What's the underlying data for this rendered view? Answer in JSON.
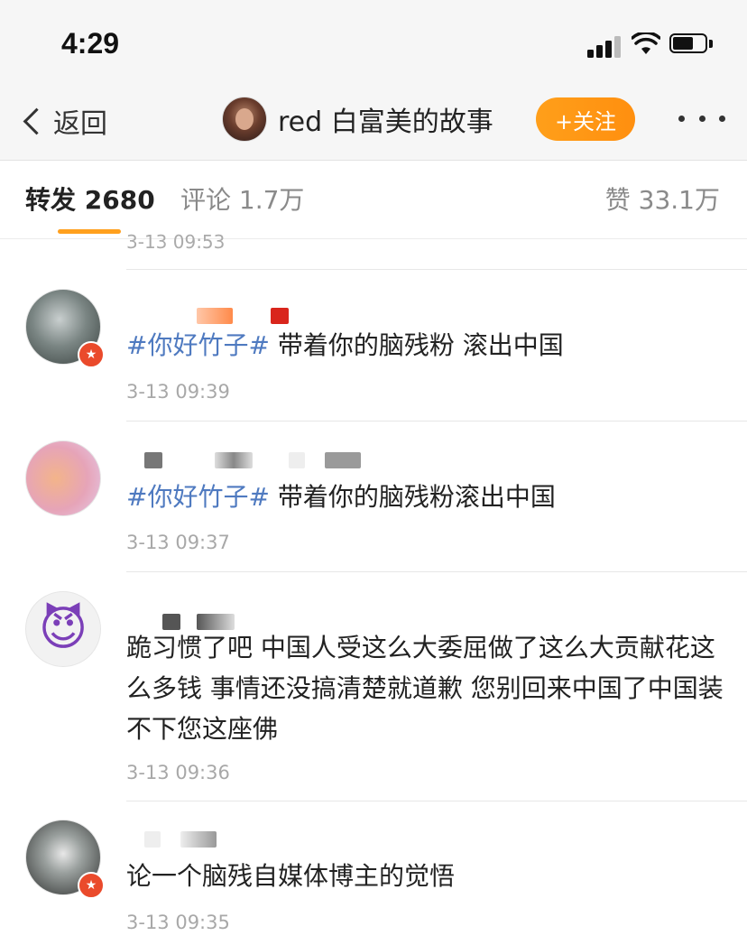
{
  "status_bar": {
    "time": "4:29"
  },
  "nav": {
    "back_label": "返回",
    "title": "red 白富美的故事",
    "follow_label": "+关注"
  },
  "tabs": {
    "repost": "转发 2680",
    "comment": "评论 1.7万",
    "like": "赞 33.1万"
  },
  "cut_off_time": "3-13 09:53",
  "comments": [
    {
      "hashtag": "#你好竹子#",
      "text": " 带着你的脑残粉 滚出中国",
      "time": "3-13 09:39"
    },
    {
      "hashtag": "#你好竹子#",
      "text": " 带着你的脑残粉滚出中国",
      "time": "3-13 09:37"
    },
    {
      "hashtag": "",
      "text": "跪习惯了吧 中国人受这么大委屈做了这么大贡献花这么多钱 事情还没搞清楚就道歉 您别回来中国了中国装不下您这座佛",
      "time": "3-13 09:36",
      "avatar_emoji": "😈"
    },
    {
      "hashtag": "",
      "text": "论一个脑残自媒体博主的觉悟",
      "time": "3-13 09:35"
    }
  ],
  "colors": {
    "hashtag": "#4f7ac0",
    "follow_button": "#ff9a16",
    "tab_underline": "#ffa01e",
    "vip_badge": "#ea4a2b"
  },
  "icons": [
    "back-chevron-icon",
    "signal-icon",
    "wifi-icon",
    "battery-icon",
    "more-dots-icon",
    "vip-badge-icon"
  ]
}
